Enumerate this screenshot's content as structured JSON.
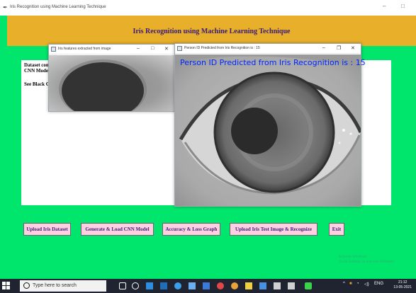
{
  "window": {
    "title": "Iris Recognition using Machine Learning Technique",
    "minimize_glyph": "–",
    "maximize_glyph": "□"
  },
  "banner": {
    "title": "Iris Recognition using Machine Learning Technique"
  },
  "text_panel": {
    "lines": [
      "Dataset cont",
      "CNN Model",
      "See Black C"
    ]
  },
  "popup_features": {
    "title": "Iris features extracted from image",
    "minimize": "–",
    "maximize": "□",
    "close": "✕"
  },
  "popup_result": {
    "title": "Person ID Predicted from Iris Recognition is : 15",
    "minimize": "–",
    "maximize": "❐",
    "close": "✕",
    "result_text": "Person ID Predicted from Iris Recognition is : 15"
  },
  "buttons": {
    "upload_dataset": "Upload Iris Dataset",
    "generate_cnn": "Generate & Load CNN Model",
    "accuracy_graph": "Accuracy & Loss Graph",
    "upload_test": "Upload Iris Test Image & Recognize",
    "exit": "Exit"
  },
  "watermark": {
    "line1": "Activate Windows",
    "line2": "Go to Settings to activate Windows."
  },
  "taskbar": {
    "search_placeholder": "Type here to search",
    "tray_text": "ENG",
    "time": "21:12",
    "date": "13-05-2021"
  },
  "colors": {
    "background": "#00e56c",
    "banner": "#e8af2a",
    "button_fill": "#ffd0e0",
    "result_text": "#0026ff"
  },
  "icons": [
    "feather-icon",
    "windows-start-icon",
    "search-icon",
    "task-view-icon",
    "edge-icon",
    "file-explorer-icon",
    "store-icon",
    "mail-icon",
    "chrome-icon",
    "tray-up-icon",
    "network-icon",
    "volume-icon"
  ]
}
